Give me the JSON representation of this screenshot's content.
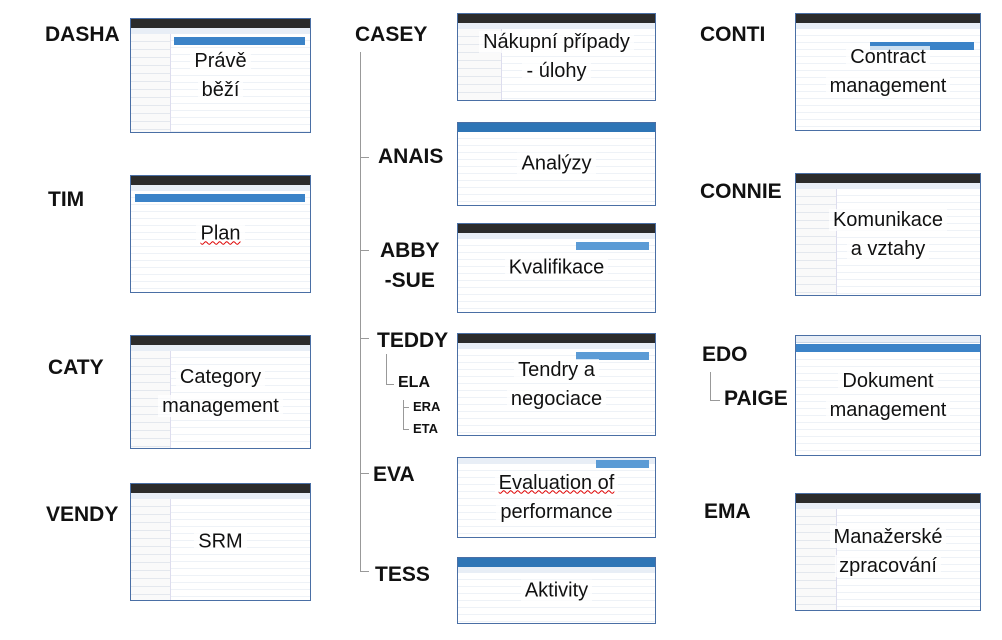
{
  "modules": [
    {
      "id": "dasha",
      "name": "DASHA",
      "caption": [
        "Právě",
        "běží"
      ]
    },
    {
      "id": "tim",
      "name": "TIM",
      "caption": [
        "Plan"
      ]
    },
    {
      "id": "caty",
      "name": "CATY",
      "caption": [
        "Category",
        "management"
      ]
    },
    {
      "id": "vendy",
      "name": "VENDY",
      "caption": [
        "SRM"
      ]
    },
    {
      "id": "casey",
      "name": "CASEY",
      "caption": [
        "Nákupní případy",
        "- úlohy"
      ]
    },
    {
      "id": "anais",
      "name": "ANAIS",
      "caption": [
        "Analýzy"
      ]
    },
    {
      "id": "abby",
      "name": [
        "ABBY",
        "-SUE"
      ],
      "caption": [
        "Kvalifikace"
      ]
    },
    {
      "id": "teddy",
      "name": "TEDDY",
      "caption": [
        "Tendry a",
        "negociace"
      ]
    },
    {
      "id": "eva",
      "name": "EVA",
      "caption": [
        "Evaluation of",
        "performance"
      ]
    },
    {
      "id": "tess",
      "name": "TESS",
      "caption": [
        "Aktivity"
      ]
    },
    {
      "id": "conti",
      "name": "CONTI",
      "caption": [
        "Contract",
        "management"
      ]
    },
    {
      "id": "connie",
      "name": "CONNIE",
      "caption": [
        "Komunikace",
        "a vztahy"
      ]
    },
    {
      "id": "edo",
      "name": "EDO",
      "caption": [
        "Dokument",
        "management"
      ]
    },
    {
      "id": "ema",
      "name": "EMA",
      "caption": [
        "Manažerské",
        "zpracování"
      ]
    }
  ],
  "submodules": {
    "ela": "ELA",
    "era": "ERA",
    "eta": "ETA",
    "paige": "PAIGE"
  }
}
